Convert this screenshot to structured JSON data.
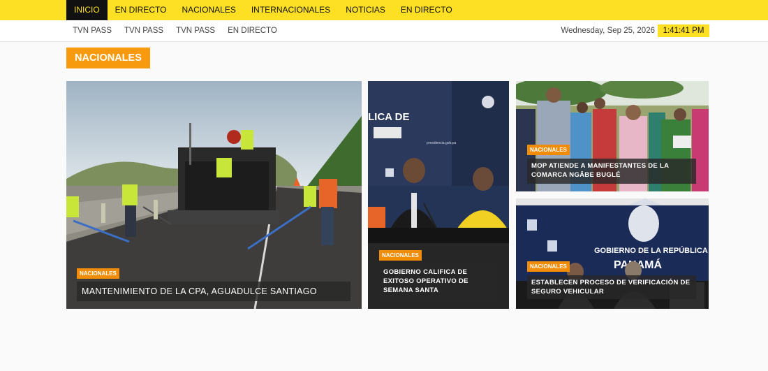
{
  "topnav": {
    "items": [
      "INICIO",
      "EN DIRECTO",
      "NACIONALES",
      "INTERNACIONALES",
      "NOTICIAS",
      "EN DIRECTO"
    ]
  },
  "subnav": {
    "links": [
      "TVN PASS",
      "TVN PASS",
      "TVN PASS",
      "EN DIRECTO"
    ],
    "date": "Wednesday, Sep 25, 2026",
    "time": "1:41:41 PM"
  },
  "section": {
    "title": "NACIONALES"
  },
  "cards": [
    {
      "tag": "NACIONALES",
      "title": "MANTENIMIENTO DE LA CPA, AGUADULCE SANTIAGO"
    },
    {
      "tag": "NACIONALES",
      "title": "GOBIERNO CALIFICA DE EXITOSO OPERATIVO DE SEMANA SANTA"
    },
    {
      "tag": "NACIONALES",
      "title": "MOP ATIENDE A MANIFESTANTES DE LA COMARCA NGÄBE BUGLÉ"
    },
    {
      "tag": "NACIONALES",
      "title": "ESTABLECEN PROCESO DE VERIFICACIÓN DE SEGURO VEHICULAR"
    }
  ],
  "photo_text": {
    "banner_c2": "LICA DE",
    "banner_c4_line1": "GOBIERNO DE LA REPÚBLICA DE",
    "banner_c4_line2": "PANAMÁ",
    "url_c2": "presidencia.gob.pa"
  },
  "colors": {
    "nav_yellow": "#fde023",
    "accent_orange": "#f89a0d",
    "tag_orange": "#f08c05"
  }
}
